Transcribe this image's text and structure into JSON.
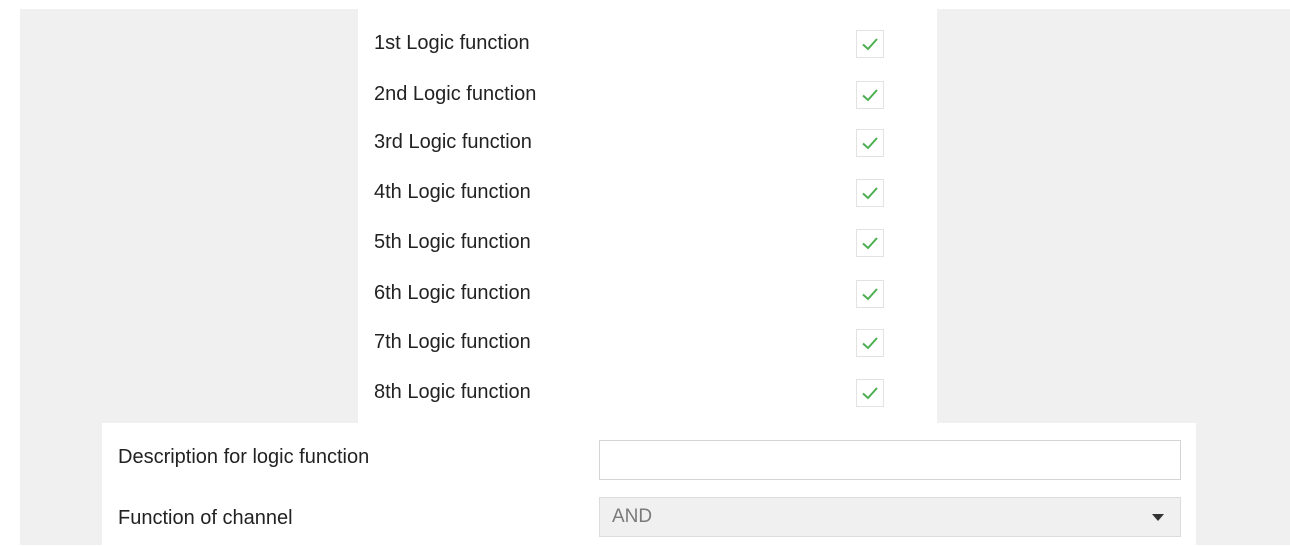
{
  "logic_functions": [
    {
      "label": "1st Logic function",
      "checked": true
    },
    {
      "label": "2nd Logic function",
      "checked": true
    },
    {
      "label": "3rd Logic function",
      "checked": true
    },
    {
      "label": "4th Logic function",
      "checked": true
    },
    {
      "label": "5th Logic function",
      "checked": true
    },
    {
      "label": "6th Logic function",
      "checked": true
    },
    {
      "label": "7th Logic function",
      "checked": true
    },
    {
      "label": "8th Logic function",
      "checked": true
    }
  ],
  "description": {
    "label": "Description for logic function",
    "value": "",
    "placeholder": ""
  },
  "channel_function": {
    "label": "Function of channel",
    "selected": "AND"
  },
  "colors": {
    "check": "#4caf50",
    "panel_gray": "#f0f0f0"
  },
  "icons": {
    "check": "check-icon",
    "dropdown": "chevron-down-icon"
  }
}
